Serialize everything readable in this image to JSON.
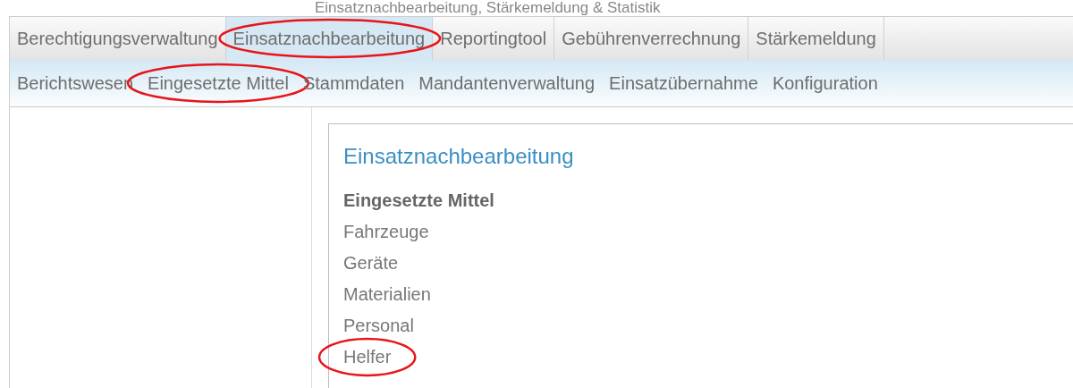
{
  "page_title": "Einsatznachbearbeitung, Stärkemeldung & Statistik",
  "tabs": [
    {
      "label": "Berechtigungsverwaltung",
      "selected": false,
      "circled": false
    },
    {
      "label": "Einsatznachbearbeitung",
      "selected": true,
      "circled": true
    },
    {
      "label": "Reportingtool",
      "selected": false,
      "circled": false
    },
    {
      "label": "Gebührenverrechnung",
      "selected": false,
      "circled": false
    },
    {
      "label": "Stärkemeldung",
      "selected": false,
      "circled": false
    }
  ],
  "subnav": [
    {
      "label": "Berichtswesen",
      "circled": false
    },
    {
      "label": "Eingesetzte Mittel",
      "circled": true
    },
    {
      "label": "Stammdaten",
      "circled": false
    },
    {
      "label": "Mandantenverwaltung",
      "circled": false
    },
    {
      "label": "Einsatzübernahme",
      "circled": false
    },
    {
      "label": "Konfiguration",
      "circled": false
    }
  ],
  "panel": {
    "title": "Einsatznachbearbeitung",
    "section": "Eingesetzte Mittel",
    "items": [
      {
        "label": "Fahrzeuge",
        "circled": false
      },
      {
        "label": "Geräte",
        "circled": false
      },
      {
        "label": "Materialien",
        "circled": false
      },
      {
        "label": "Personal",
        "circled": false
      },
      {
        "label": "Helfer",
        "circled": true
      }
    ]
  }
}
